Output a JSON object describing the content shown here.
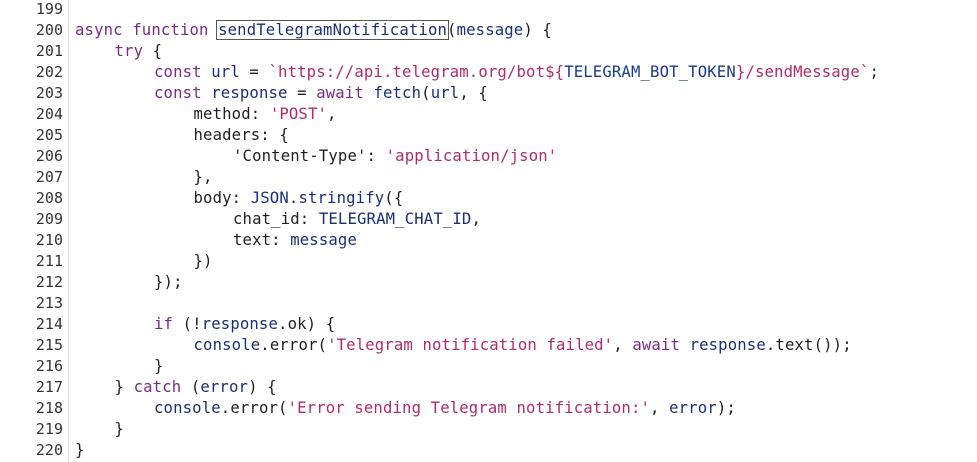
{
  "editor": {
    "lines": [
      {
        "num": "199",
        "indent": 0,
        "tokens": []
      },
      {
        "num": "200",
        "indent": 0,
        "tokens": [
          {
            "t": "async",
            "c": "kw"
          },
          {
            "t": " "
          },
          {
            "t": "function",
            "c": "kw"
          },
          {
            "t": " "
          },
          {
            "t": "sendTelegramNotification",
            "c": "ident",
            "hl": true
          },
          {
            "t": "("
          },
          {
            "t": "message",
            "c": "ident"
          },
          {
            "t": ") {"
          }
        ]
      },
      {
        "num": "201",
        "indent": 1,
        "tokens": [
          {
            "t": "try",
            "c": "kw"
          },
          {
            "t": " {"
          }
        ]
      },
      {
        "num": "202",
        "indent": 2,
        "tokens": [
          {
            "t": "const",
            "c": "kw"
          },
          {
            "t": " "
          },
          {
            "t": "url",
            "c": "ident"
          },
          {
            "t": " = "
          },
          {
            "t": "`https://api.telegram.org/bot${",
            "c": "str"
          },
          {
            "t": "TELEGRAM_BOT_TOKEN",
            "c": "tpl"
          },
          {
            "t": "}/sendMessage`",
            "c": "str"
          },
          {
            "t": ";"
          }
        ]
      },
      {
        "num": "203",
        "indent": 2,
        "tokens": [
          {
            "t": "const",
            "c": "kw"
          },
          {
            "t": " "
          },
          {
            "t": "response",
            "c": "ident"
          },
          {
            "t": " = "
          },
          {
            "t": "await",
            "c": "kw"
          },
          {
            "t": " "
          },
          {
            "t": "fetch",
            "c": "ident"
          },
          {
            "t": "("
          },
          {
            "t": "url",
            "c": "ident"
          },
          {
            "t": ", {"
          }
        ]
      },
      {
        "num": "204",
        "indent": 3,
        "tokens": [
          {
            "t": "method"
          },
          {
            "t": ": "
          },
          {
            "t": "'POST'",
            "c": "str"
          },
          {
            "t": ","
          }
        ]
      },
      {
        "num": "205",
        "indent": 3,
        "tokens": [
          {
            "t": "headers"
          },
          {
            "t": ": {"
          }
        ]
      },
      {
        "num": "206",
        "indent": 4,
        "tokens": [
          {
            "t": "'Content-Type'"
          },
          {
            "t": ": "
          },
          {
            "t": "'application/json'",
            "c": "str"
          }
        ]
      },
      {
        "num": "207",
        "indent": 3,
        "tokens": [
          {
            "t": "},"
          }
        ]
      },
      {
        "num": "208",
        "indent": 3,
        "tokens": [
          {
            "t": "body"
          },
          {
            "t": ": "
          },
          {
            "t": "JSON",
            "c": "ident"
          },
          {
            "t": "."
          },
          {
            "t": "stringify",
            "c": "ident"
          },
          {
            "t": "({"
          }
        ]
      },
      {
        "num": "209",
        "indent": 4,
        "tokens": [
          {
            "t": "chat_id"
          },
          {
            "t": ": "
          },
          {
            "t": "TELEGRAM_CHAT_ID",
            "c": "ident"
          },
          {
            "t": ","
          }
        ]
      },
      {
        "num": "210",
        "indent": 4,
        "tokens": [
          {
            "t": "text"
          },
          {
            "t": ": "
          },
          {
            "t": "message",
            "c": "ident"
          }
        ]
      },
      {
        "num": "211",
        "indent": 3,
        "tokens": [
          {
            "t": "})"
          }
        ]
      },
      {
        "num": "212",
        "indent": 2,
        "tokens": [
          {
            "t": "});"
          }
        ]
      },
      {
        "num": "213",
        "indent": 0,
        "tokens": []
      },
      {
        "num": "214",
        "indent": 2,
        "tokens": [
          {
            "t": "if",
            "c": "kw"
          },
          {
            "t": " (!"
          },
          {
            "t": "response",
            "c": "ident"
          },
          {
            "t": "."
          },
          {
            "t": "ok"
          },
          {
            "t": ") {"
          }
        ]
      },
      {
        "num": "215",
        "indent": 3,
        "tokens": [
          {
            "t": "console",
            "c": "ident"
          },
          {
            "t": "."
          },
          {
            "t": "error"
          },
          {
            "t": "("
          },
          {
            "t": "'Telegram notification failed'",
            "c": "str"
          },
          {
            "t": ", "
          },
          {
            "t": "await",
            "c": "kw"
          },
          {
            "t": " "
          },
          {
            "t": "response",
            "c": "ident"
          },
          {
            "t": "."
          },
          {
            "t": "text"
          },
          {
            "t": "());"
          }
        ]
      },
      {
        "num": "216",
        "indent": 2,
        "tokens": [
          {
            "t": "}"
          }
        ]
      },
      {
        "num": "217",
        "indent": 1,
        "tokens": [
          {
            "t": "} "
          },
          {
            "t": "catch",
            "c": "kw"
          },
          {
            "t": " ("
          },
          {
            "t": "error",
            "c": "ident"
          },
          {
            "t": ") {"
          }
        ]
      },
      {
        "num": "218",
        "indent": 2,
        "tokens": [
          {
            "t": "console",
            "c": "ident"
          },
          {
            "t": "."
          },
          {
            "t": "error"
          },
          {
            "t": "("
          },
          {
            "t": "'Error sending Telegram notification:'",
            "c": "str"
          },
          {
            "t": ", "
          },
          {
            "t": "error",
            "c": "ident"
          },
          {
            "t": ");"
          }
        ]
      },
      {
        "num": "219",
        "indent": 1,
        "tokens": [
          {
            "t": "}"
          }
        ]
      },
      {
        "num": "220",
        "indent": 0,
        "tokens": [
          {
            "t": "}"
          }
        ]
      }
    ]
  }
}
